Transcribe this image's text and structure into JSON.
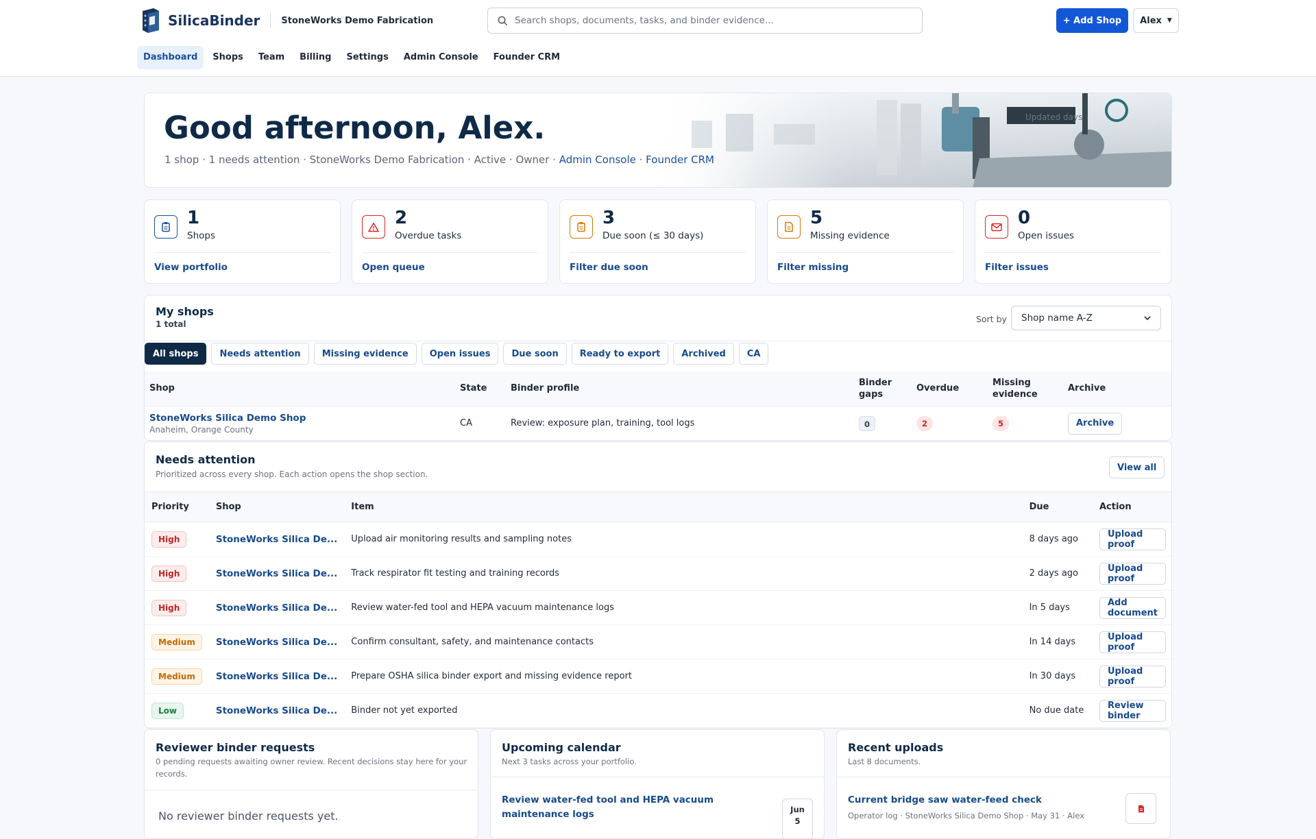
{
  "header": {
    "brand": "SilicaBinder",
    "org": "StoneWorks Demo Fabrication",
    "search_placeholder": "Search shops, documents, tasks, and binder evidence...",
    "add_shop": "+ Add Shop",
    "user": "Alex",
    "accent": "#1257d6"
  },
  "nav": [
    "Dashboard",
    "Shops",
    "Team",
    "Billing",
    "Settings",
    "Admin Console",
    "Founder CRM"
  ],
  "hero": {
    "greeting": "Good afternoon, Alex.",
    "summary": "1 shop · 1 needs attention · StoneWorks Demo Fabrication · Active · Owner · ",
    "link_admin": "Admin Console",
    "sep": " · ",
    "link_crm": "Founder CRM",
    "updated": "Updated days"
  },
  "stats": [
    {
      "value": "1",
      "label": "Shops",
      "action": "View portfolio",
      "icon": "clipboard-icon",
      "color": "#1a4f9c"
    },
    {
      "value": "2",
      "label": "Overdue tasks",
      "action": "Open queue",
      "icon": "warning-icon",
      "color": "#dc2626"
    },
    {
      "value": "3",
      "label": "Due soon (≤ 30 days)",
      "action": "Filter due soon",
      "icon": "clipboard-icon",
      "color": "#d97706"
    },
    {
      "value": "5",
      "label": "Missing evidence",
      "action": "Filter missing",
      "icon": "document-icon",
      "color": "#d97706"
    },
    {
      "value": "0",
      "label": "Open issues",
      "action": "Filter issues",
      "icon": "mail-icon",
      "color": "#dc2626"
    }
  ],
  "shops": {
    "title": "My shops",
    "count": "1 total",
    "sort_label": "Sort by",
    "sort_value": "Shop name A-Z",
    "filters": [
      "All shops",
      "Needs attention",
      "Missing evidence",
      "Open issues",
      "Due soon",
      "Ready to export",
      "Archived",
      "CA"
    ],
    "columns": [
      "Shop",
      "State",
      "Binder profile",
      "Binder gaps",
      "Overdue",
      "Missing evidence",
      "Archive"
    ],
    "rows": [
      {
        "name": "StoneWorks Silica Demo Shop",
        "location": "Anaheim, Orange County",
        "state": "CA",
        "profile": "Review: exposure plan, training, tool logs",
        "gaps": "0",
        "overdue": "2",
        "missing": "5",
        "action": "Archive"
      }
    ]
  },
  "attention": {
    "title": "Needs attention",
    "desc": "Prioritized across every shop. Each action opens the shop section.",
    "view_all": "View all",
    "columns": [
      "Priority",
      "Shop",
      "Item",
      "Due",
      "Action"
    ],
    "rows": [
      {
        "priority": "High",
        "level": "high",
        "shop": "StoneWorks Silica De...",
        "item": "Upload air monitoring results and sampling notes",
        "due": "8 days ago",
        "action": "Upload proof"
      },
      {
        "priority": "High",
        "level": "high",
        "shop": "StoneWorks Silica De...",
        "item": "Track respirator fit testing and training records",
        "due": "2 days ago",
        "action": "Upload proof"
      },
      {
        "priority": "High",
        "level": "high",
        "shop": "StoneWorks Silica De...",
        "item": "Review water-fed tool and HEPA vacuum maintenance logs",
        "due": "In 5 days",
        "action": "Add document"
      },
      {
        "priority": "Medium",
        "level": "medium",
        "shop": "StoneWorks Silica De...",
        "item": "Confirm consultant, safety, and maintenance contacts",
        "due": "In 14 days",
        "action": "Upload proof"
      },
      {
        "priority": "Medium",
        "level": "medium",
        "shop": "StoneWorks Silica De...",
        "item": "Prepare OSHA silica binder export and missing evidence report",
        "due": "In 30 days",
        "action": "Upload proof"
      },
      {
        "priority": "Low",
        "level": "low",
        "shop": "StoneWorks Silica De...",
        "item": "Binder not yet exported",
        "due": "No due date",
        "action": "Review binder"
      }
    ]
  },
  "reviewer": {
    "title": "Reviewer binder requests",
    "desc": "0 pending requests awaiting owner review. Recent decisions stay here for your records.",
    "empty": "No reviewer binder requests yet."
  },
  "calendar": {
    "title": "Upcoming calendar",
    "desc": "Next 3 tasks across your portfolio.",
    "item": "Review water-fed tool and HEPA vacuum maintenance logs",
    "month": "Jun",
    "day": "5"
  },
  "uploads": {
    "title": "Recent uploads",
    "desc": "Last 8 documents.",
    "item": "Current bridge saw water-feed check",
    "meta": "Operator log · StoneWorks Silica Demo Shop · May 31 · Alex"
  }
}
